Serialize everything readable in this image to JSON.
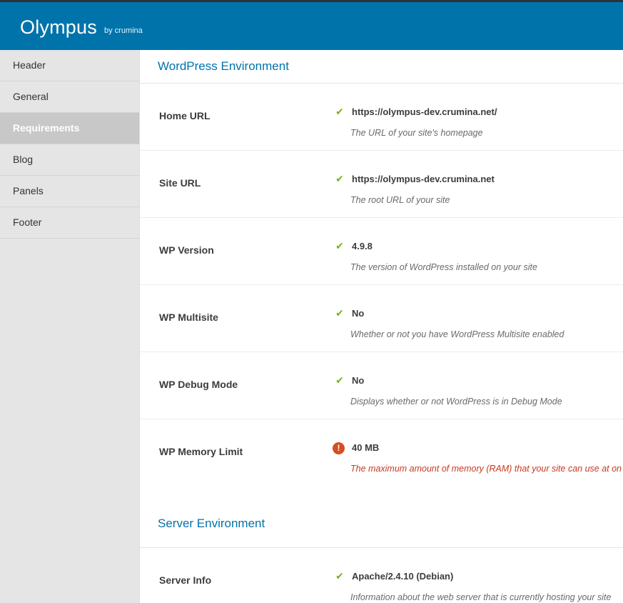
{
  "app": {
    "title": "Olympus",
    "byline": "by crumina",
    "accent_color": "#0073aa"
  },
  "sidebar": {
    "items": [
      {
        "label": "Header",
        "active": false
      },
      {
        "label": "General",
        "active": false
      },
      {
        "label": "Requirements",
        "active": true
      },
      {
        "label": "Blog",
        "active": false
      },
      {
        "label": "Panels",
        "active": false
      },
      {
        "label": "Footer",
        "active": false
      }
    ]
  },
  "sections": {
    "wordpress": {
      "title": "WordPress Environment",
      "rows": [
        {
          "label": "Home URL",
          "status": "check-icon",
          "value": "https://olympus-dev.crumina.net/",
          "description": "The URL of your site's homepage"
        },
        {
          "label": "Site URL",
          "status": "check-icon",
          "value": "https://olympus-dev.crumina.net",
          "description": "The root URL of your site"
        },
        {
          "label": "WP Version",
          "status": "check-icon",
          "value": "4.9.8",
          "description": "The version of WordPress installed on your site"
        },
        {
          "label": "WP Multisite",
          "status": "check-icon",
          "value": "No",
          "description": "Whether or not you have WordPress Multisite enabled"
        },
        {
          "label": "WP Debug Mode",
          "status": "check-icon",
          "value": "No",
          "description": "Displays whether or not WordPress is in Debug Mode"
        },
        {
          "label": "WP Memory Limit",
          "status": "warning-icon",
          "value": "40 MB",
          "description": "The maximum amount of memory (RAM) that your site can use at on"
        }
      ]
    },
    "server": {
      "title": "Server Environment",
      "rows": [
        {
          "label": "Server Info",
          "status": "check-icon",
          "value": "Apache/2.4.10 (Debian)",
          "description": "Information about the web server that is currently hosting your site"
        }
      ]
    }
  },
  "colors": {
    "check": "#7ab317",
    "warning": "#d54e21",
    "warning_text": "#c9381f"
  }
}
